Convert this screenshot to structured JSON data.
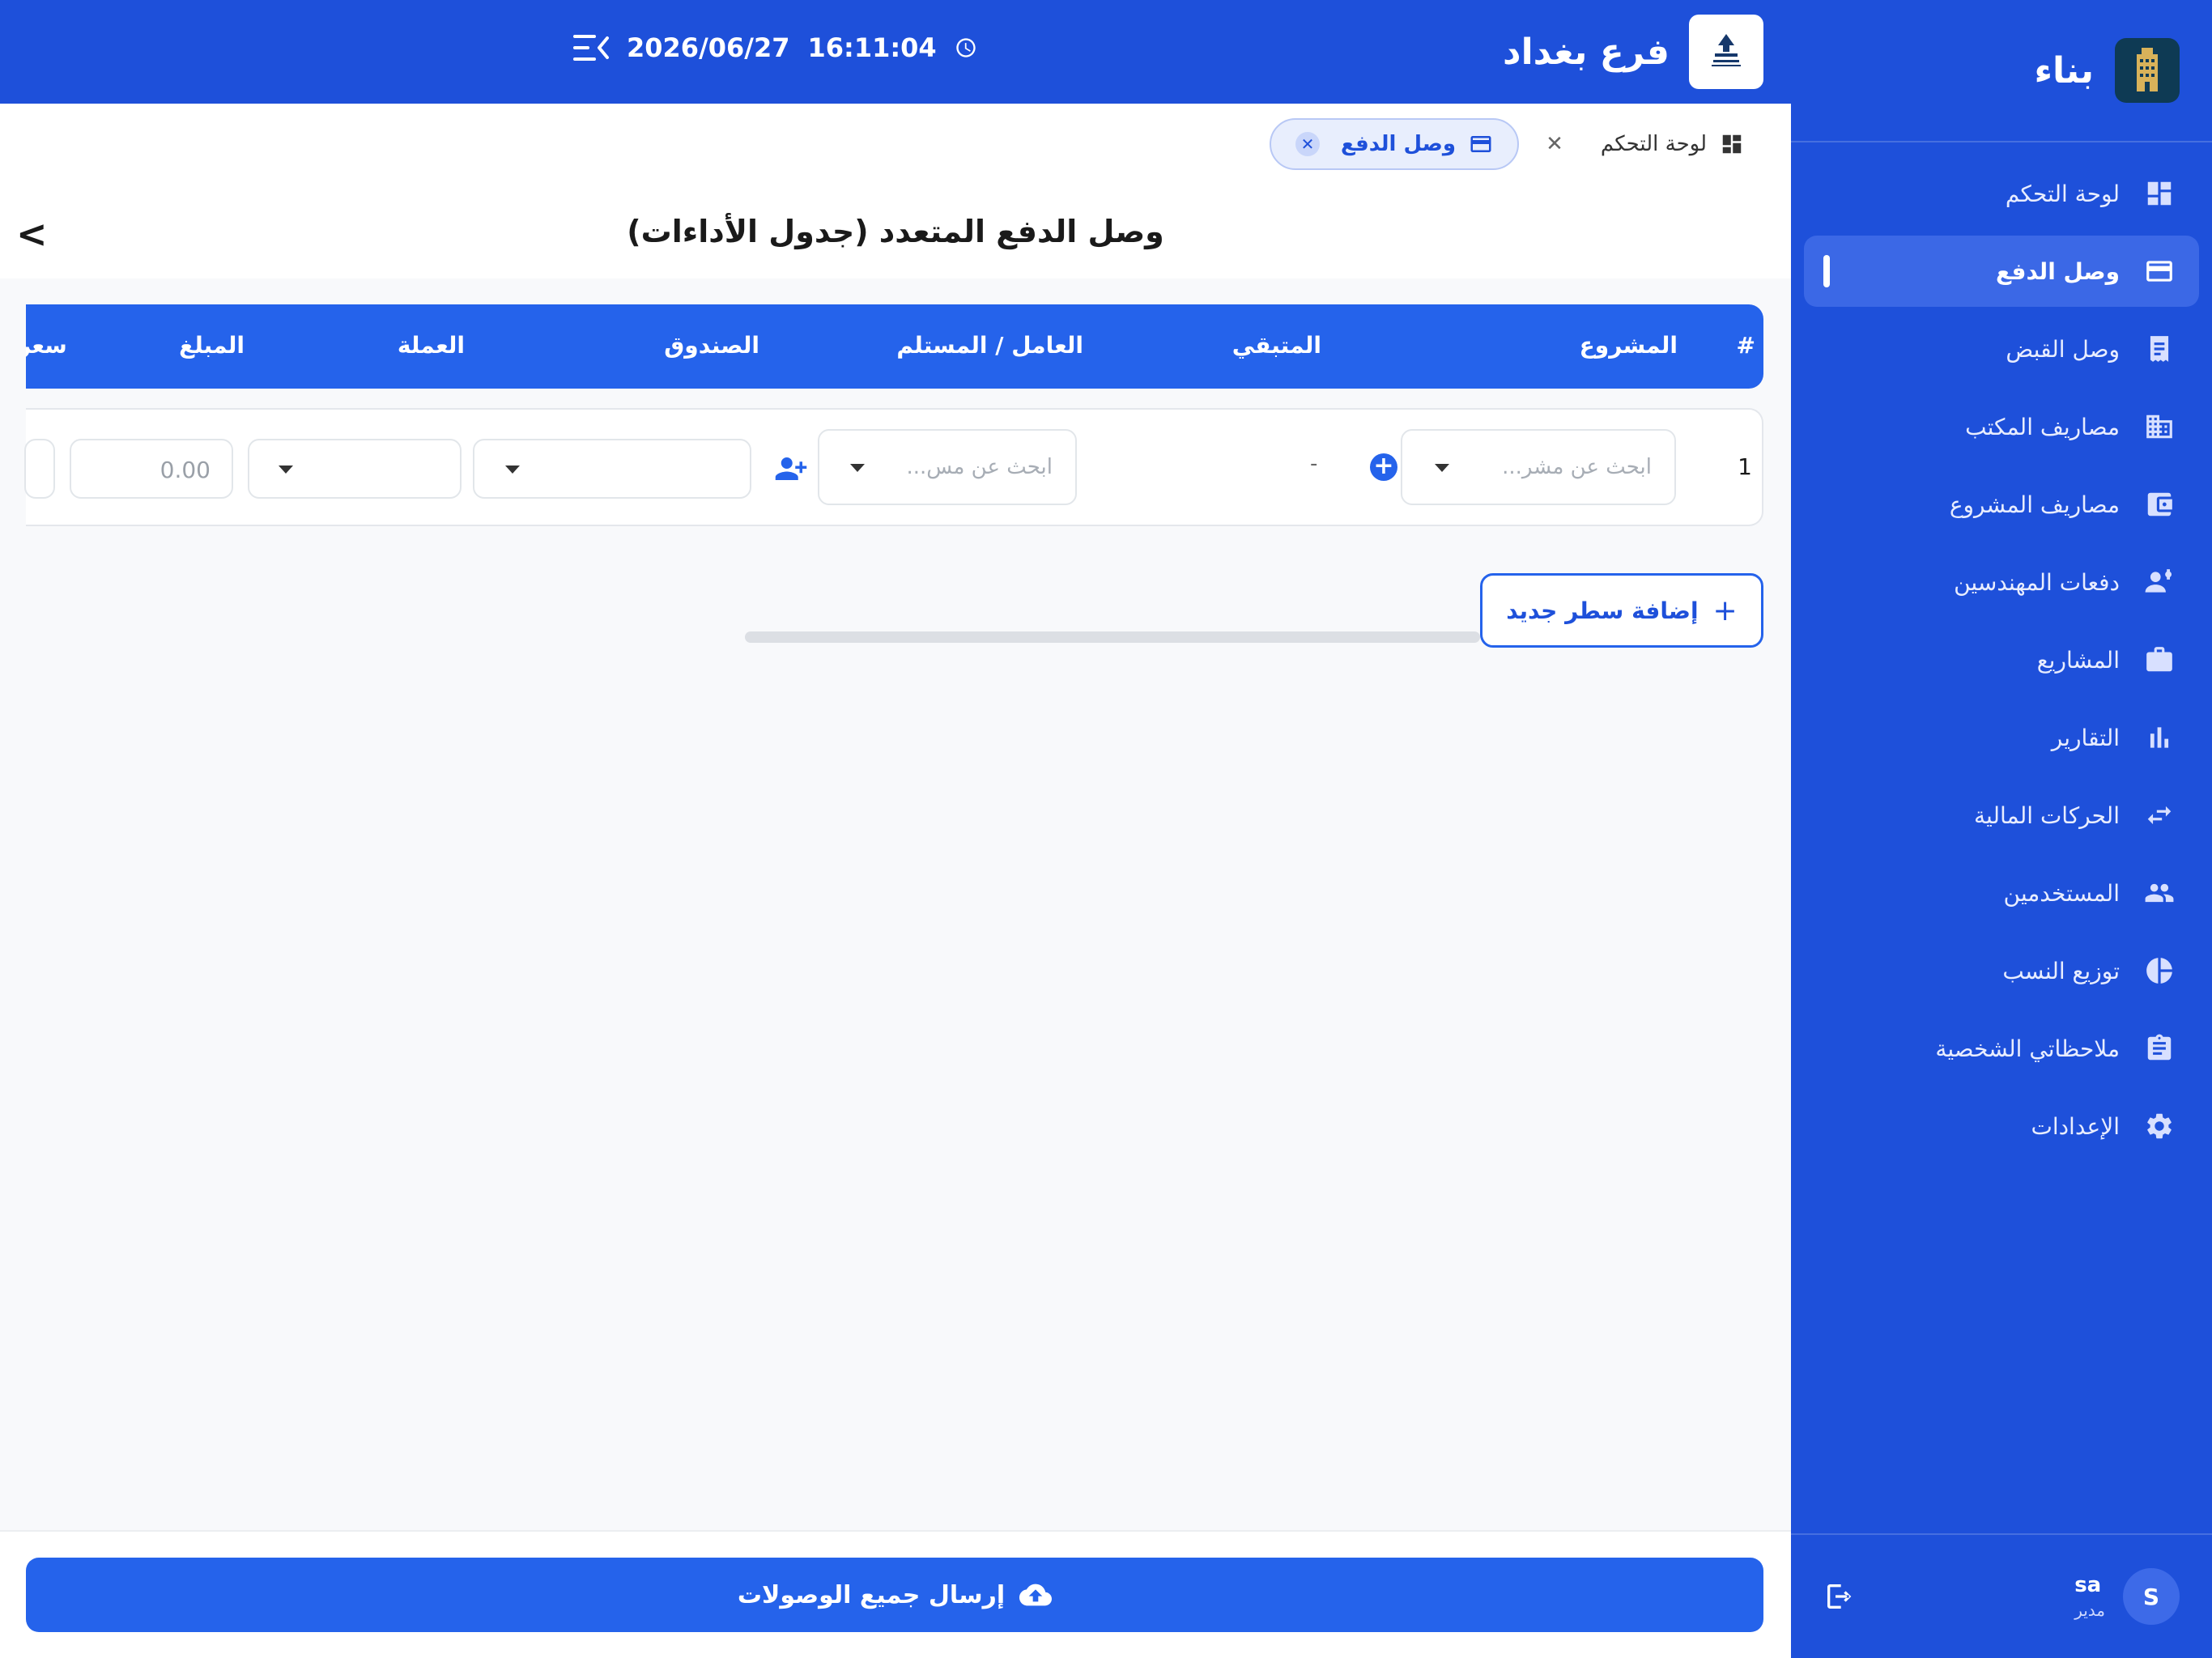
{
  "app": {
    "name": "بناء",
    "logo_icon": "building-logo-icon"
  },
  "header": {
    "branch_name": "فرع بغداد",
    "branch_logo_icon": "company-logo-icon",
    "time": "16:11:04",
    "date": "2026/06/27"
  },
  "tabs": [
    {
      "label": "لوحة التحكم",
      "icon": "dashboard-icon",
      "active": false
    },
    {
      "label": "وصل الدفع",
      "icon": "card-icon",
      "active": true
    }
  ],
  "sidebar": {
    "items": [
      {
        "label": "لوحة التحكم",
        "icon": "dashboard-icon",
        "active": false
      },
      {
        "label": "وصل الدفع",
        "icon": "card-icon",
        "active": true
      },
      {
        "label": "وصل القبض",
        "icon": "receipt-icon",
        "active": false
      },
      {
        "label": "مصاريف المكتب",
        "icon": "building-icon",
        "active": false
      },
      {
        "label": "مصاريف المشروع",
        "icon": "wallet-icon",
        "active": false
      },
      {
        "label": "دفعات المهندسين",
        "icon": "engineer-icon",
        "active": false
      },
      {
        "label": "المشاريع",
        "icon": "briefcase-icon",
        "active": false
      },
      {
        "label": "التقارير",
        "icon": "bar-chart-icon",
        "active": false
      },
      {
        "label": "الحركات المالية",
        "icon": "transfer-icon",
        "active": false
      },
      {
        "label": "المستخدمين",
        "icon": "users-icon",
        "active": false
      },
      {
        "label": "توزيع النسب",
        "icon": "pie-chart-icon",
        "active": false
      },
      {
        "label": "ملاحظاتي الشخصية",
        "icon": "clipboard-icon",
        "active": false
      },
      {
        "label": "الإعدادات",
        "icon": "gear-icon",
        "active": false
      }
    ]
  },
  "user": {
    "initial": "S",
    "name": "sa",
    "role": "مدير"
  },
  "page": {
    "title": "وصل الدفع المتعدد (جدول الأداءات)",
    "back_symbol": "<"
  },
  "table": {
    "headers": {
      "num": "#",
      "project": "المشروع",
      "remaining": "المتبقي",
      "worker": "العامل / المستلم",
      "fund": "الصندوق",
      "currency": "العملة",
      "amount": "المبلغ",
      "rate": "سعر"
    },
    "row": {
      "number": "1",
      "project_placeholder": "ابحث عن مشر...",
      "remaining": "-",
      "worker_placeholder": "ابحث عن مس...",
      "amount_placeholder": "0.00"
    }
  },
  "actions": {
    "add_row": "إضافة سطر جديد",
    "submit_all": "إرسال جميع الوصولات"
  },
  "colors": {
    "primary": "#1e50da",
    "accent": "#2563eb"
  }
}
